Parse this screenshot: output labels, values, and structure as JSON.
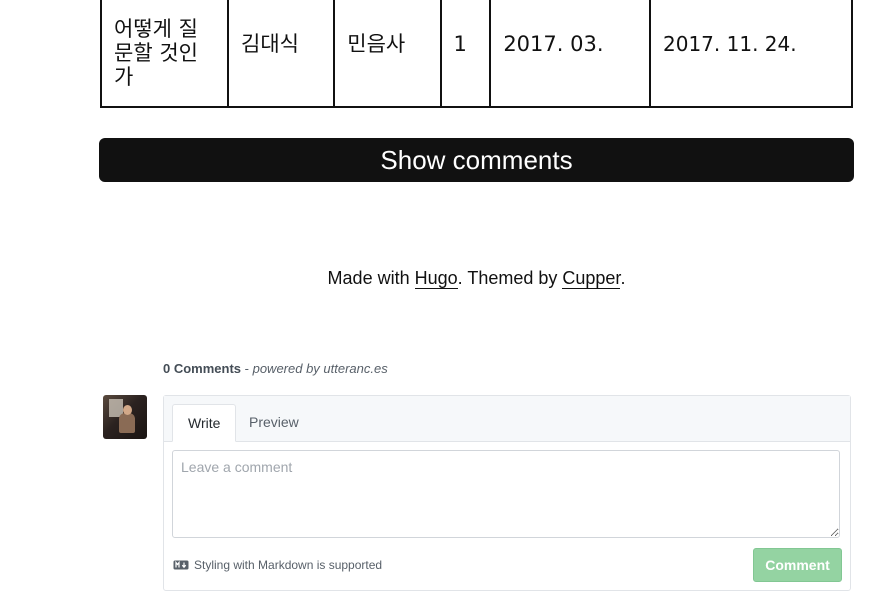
{
  "table": {
    "row": {
      "title": "어떻게 질문할 것인가",
      "author": "김대식",
      "publisher": "민음사",
      "count": "1",
      "start_date": "2017. 03.",
      "end_date": "2017. 11. 24."
    }
  },
  "show_comments": {
    "label": "Show comments"
  },
  "footer": {
    "made_with": "Made with",
    "hugo": "Hugo",
    "themed_by": ". Themed by",
    "cupper": "Cupper",
    "end": "."
  },
  "comments": {
    "count_label": "0 Comments",
    "separator": " - ",
    "powered_by": "powered by utteranc.es",
    "tabs": {
      "write": "Write",
      "preview": "Preview"
    },
    "textarea_placeholder": "Leave a comment",
    "markdown_note": "Styling with Markdown is supported",
    "submit_label": "Comment",
    "submit_color": "#94d3a2"
  }
}
